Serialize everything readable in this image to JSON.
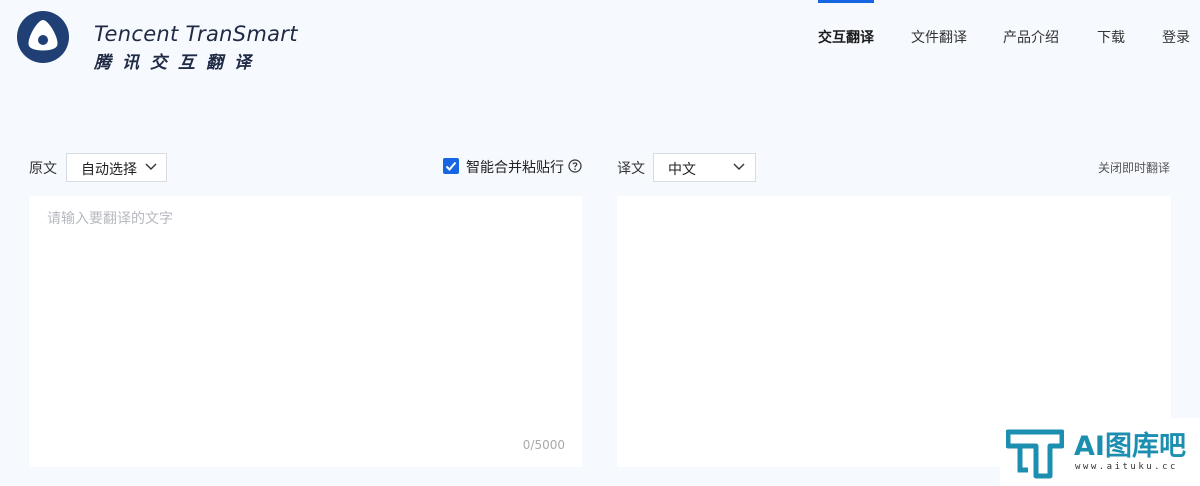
{
  "brand": {
    "name_en": "Tencent TranSmart",
    "name_zh": "腾讯交互翻译",
    "color": "#1f2a44"
  },
  "nav": {
    "items": [
      {
        "label": "交互翻译",
        "active": true
      },
      {
        "label": "文件翻译",
        "active": false
      },
      {
        "label": "产品介绍",
        "active": false
      },
      {
        "label": "下载",
        "active": false
      },
      {
        "label": "登录",
        "active": false
      }
    ]
  },
  "source": {
    "label": "原文",
    "language": "自动选择",
    "placeholder": "请输入要翻译的文字",
    "char_count": "0/5000"
  },
  "merge_paste": {
    "label": "智能合并粘贴行",
    "checked": true,
    "help_icon": "question-circle-icon"
  },
  "target": {
    "label": "译文",
    "language": "中文",
    "close_instant": "关闭即时翻译"
  },
  "watermark": {
    "title": "AI图库吧",
    "url": "www.aituku.cc"
  },
  "colors": {
    "accent": "#1566e0",
    "background": "#f6f9fe",
    "panel": "#ffffff"
  }
}
